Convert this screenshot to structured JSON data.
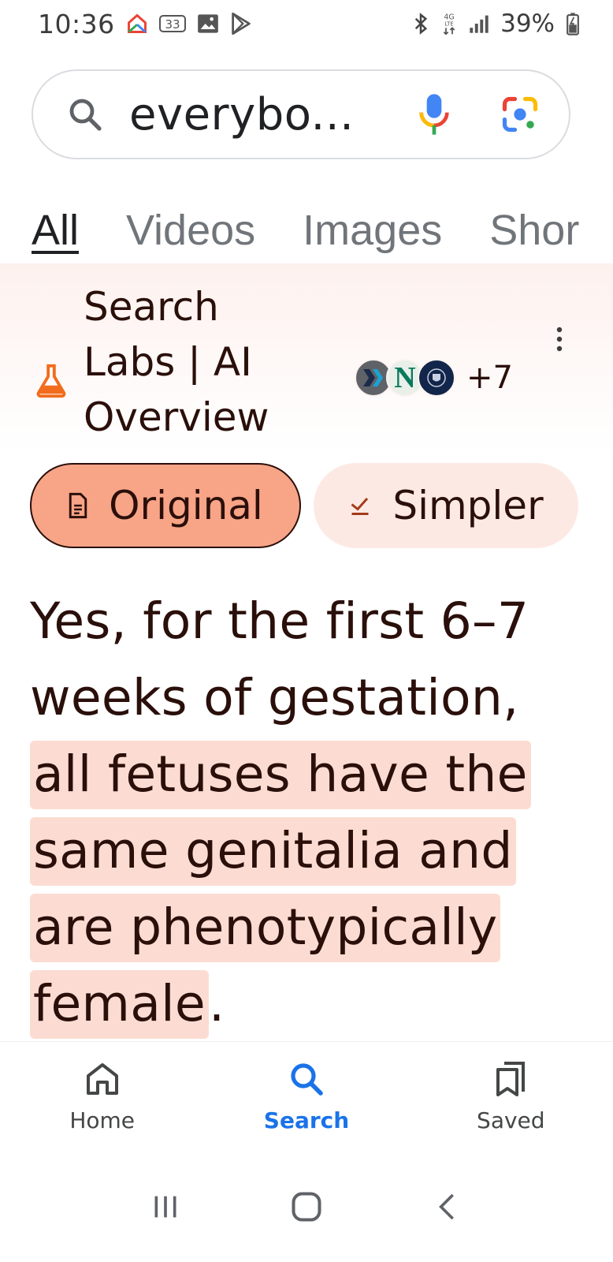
{
  "status_bar": {
    "time": "10:36",
    "notification_badge": "33",
    "battery": "39%",
    "icons": [
      "google-home-icon",
      "notification-count-icon",
      "gallery-icon",
      "play-store-icon",
      "bluetooth-icon",
      "4g-lte-icon",
      "signal-icon",
      "battery-charging-icon"
    ]
  },
  "search": {
    "query": "everybo..."
  },
  "tabs": [
    {
      "label": "All",
      "active": true
    },
    {
      "label": "Videos",
      "active": false
    },
    {
      "label": "Images",
      "active": false
    },
    {
      "label": "Shor",
      "active": false
    }
  ],
  "ai_overview": {
    "title": "Search Labs | AI Overview",
    "source_count": "+7",
    "original_label": "Original",
    "simpler_label": "Simpler",
    "answer_plain": "Yes, for the first 6–7 weeks of gestation, ",
    "answer_highlight_1": "all fetuses have the same genitalia and are phenotypically",
    "answer_highlight_2": "female",
    "answer_end": "."
  },
  "bottom_nav": {
    "home": "Home",
    "search": "Search",
    "saved": "Saved"
  },
  "colors": {
    "accent_blue": "#1a73e8",
    "highlight": "#fcdcd2",
    "chip_active": "#f8a487",
    "text_dark": "#2a0f0a"
  }
}
